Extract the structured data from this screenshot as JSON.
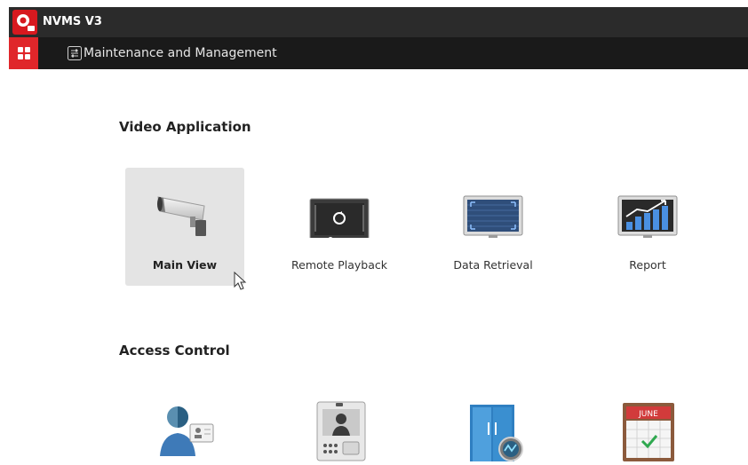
{
  "app": {
    "title": "NVMS V3"
  },
  "menubar": {
    "tab_label": "Maintenance and Management"
  },
  "sections": {
    "video": {
      "title": "Video Application",
      "tiles": [
        {
          "label": "Main View",
          "icon": "camera-icon",
          "selected": true
        },
        {
          "label": "Remote Playback",
          "icon": "playback-icon"
        },
        {
          "label": "Data Retrieval",
          "icon": "data-retrieval-icon"
        },
        {
          "label": "Report",
          "icon": "report-chart-icon"
        }
      ]
    },
    "access": {
      "title": "Access Control",
      "tiles": [
        {
          "icon": "person-card-icon"
        },
        {
          "icon": "video-intercom-icon"
        },
        {
          "icon": "door-icon"
        },
        {
          "icon": "calendar-icon",
          "badge_text": "JUNE"
        }
      ]
    }
  },
  "colors": {
    "accent": "#e0262a",
    "titlebar": "#2b2b2b",
    "menubar": "#1a1a1a",
    "tile_selected": "#e4e4e4"
  }
}
